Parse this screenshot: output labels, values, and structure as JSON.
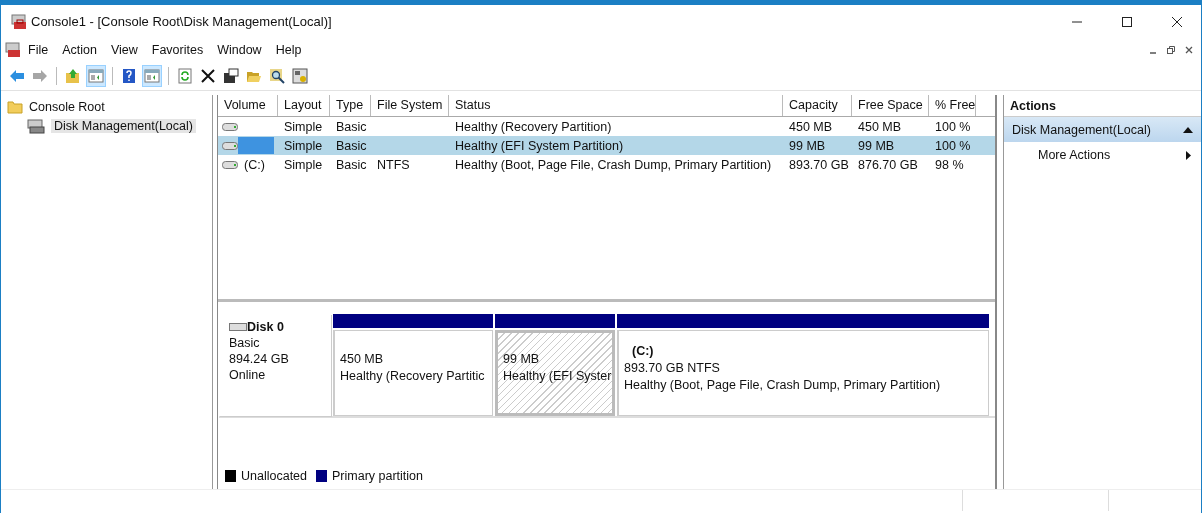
{
  "window": {
    "title": "Console1 - [Console Root\\Disk Management(Local)]"
  },
  "menu": [
    "File",
    "Action",
    "View",
    "Favorites",
    "Window",
    "Help"
  ],
  "toolbar": [
    [
      {
        "kind": "back",
        "pressed": false,
        "disabled": false
      },
      {
        "kind": "forward",
        "pressed": false,
        "disabled": true
      }
    ],
    [
      {
        "kind": "up",
        "pressed": false,
        "disabled": false
      },
      {
        "kind": "pane",
        "pressed": true,
        "disabled": false
      }
    ],
    [
      {
        "kind": "help",
        "pressed": false,
        "disabled": false
      },
      {
        "kind": "pane",
        "pressed": true,
        "disabled": false
      }
    ],
    [
      {
        "kind": "refresh",
        "pressed": false,
        "disabled": false
      },
      {
        "kind": "delete",
        "pressed": false,
        "disabled": false
      },
      {
        "kind": "properties",
        "pressed": false,
        "disabled": false
      },
      {
        "kind": "open",
        "pressed": false,
        "disabled": false
      },
      {
        "kind": "find",
        "pressed": false,
        "disabled": false
      },
      {
        "kind": "settings",
        "pressed": false,
        "disabled": false
      }
    ]
  ],
  "tree": [
    {
      "label": "Console Root",
      "selected": false,
      "children": [
        {
          "label": "Disk Management(Local)",
          "selected": true
        }
      ]
    }
  ],
  "table": {
    "columns": [
      "Volume",
      "Layout",
      "Type",
      "File System",
      "Status",
      "Capacity",
      "Free Space",
      "% Free"
    ],
    "rows": [
      {
        "selected": false,
        "cells": [
          "",
          "Simple",
          "Basic",
          "",
          "Healthy (Recovery Partition)",
          "450 MB",
          "450 MB",
          "100 %"
        ]
      },
      {
        "selected": true,
        "cells": [
          "",
          "Simple",
          "Basic",
          "",
          "Healthy (EFI System Partition)",
          "99 MB",
          "99 MB",
          "100 %"
        ]
      },
      {
        "selected": false,
        "cells": [
          "(C:)",
          "Simple",
          "Basic",
          "NTFS",
          "Healthy (Boot, Page File, Crash Dump, Primary Partition)",
          "893.70 GB",
          "876.70 GB",
          "98 %"
        ]
      }
    ]
  },
  "disk": {
    "name": "Disk 0",
    "type": "Basic",
    "size": "894.24 GB",
    "status": "Online",
    "partitions": [
      {
        "size": "450 MB",
        "status": "Healthy (Recovery Partitic",
        "selected": false,
        "color": "#000080"
      },
      {
        "size": "99 MB",
        "status": "Healthy (EFI Syster",
        "selected": true,
        "color": "#000080"
      },
      {
        "label": "(C:)",
        "size": "893.70 GB NTFS",
        "status": "Healthy (Boot, Page File, Crash Dump, Primary Partition)",
        "selected": false,
        "color": "#000080"
      }
    ]
  },
  "legend": [
    {
      "label": "Unallocated",
      "color": "#000000"
    },
    {
      "label": "Primary partition",
      "color": "#000080"
    }
  ],
  "actions": {
    "title": "Actions",
    "items": [
      {
        "label": "Disk Management(Local)",
        "kind": "header"
      },
      {
        "label": "More Actions",
        "kind": "item"
      }
    ]
  }
}
